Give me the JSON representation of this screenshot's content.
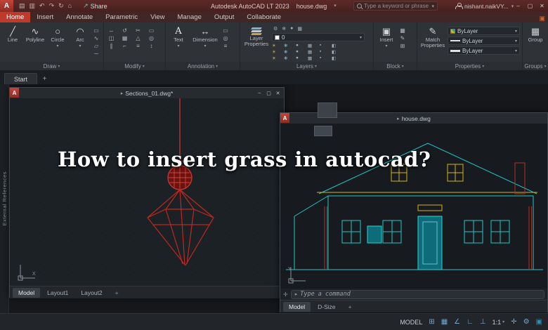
{
  "title_bar": {
    "app_title": "Autodesk AutoCAD LT 2023",
    "doc_title": "house.dwg",
    "share_label": "Share",
    "search_placeholder": "Type a keyword or phrase",
    "user_name": "nishant.naikVY..."
  },
  "icons": {
    "logo": "A",
    "qat": [
      "▤",
      "▥",
      "↶",
      "↷",
      "↻",
      "⌂"
    ],
    "share": "↗",
    "caret": "▾",
    "dwg_marker": "▸",
    "minimize": "–",
    "maximize": "▢",
    "close": "✕",
    "plus": "+",
    "ribbon_end": "▣",
    "draw_small": [
      "▭",
      "◇",
      "∿",
      "◯",
      "▱",
      "╳",
      "─",
      "∠"
    ],
    "modify": [
      "↔",
      "↺",
      "✂",
      "▭",
      "◫",
      "▦",
      "△",
      "◎",
      "∥",
      "⌐",
      "≡",
      "↕"
    ],
    "annotation_small": [
      "▭",
      "◎",
      "≡"
    ],
    "layers_top": [
      "⚙",
      "❄",
      "●",
      "▦"
    ],
    "layers_grid": [
      "☀",
      "❄",
      "●",
      "▦",
      "▪",
      "◧",
      "☀",
      "❄",
      "●",
      "▦",
      "▪",
      "◧",
      "☀",
      "❄",
      "●",
      "▦",
      "▪",
      "◧"
    ],
    "block_small": [
      "▦",
      "✎",
      "⊞"
    ],
    "cmd_prompt": "▸",
    "cmd_tool": "✛",
    "status": [
      "⊞",
      "▦",
      "∠",
      "∟",
      "⊥"
    ],
    "status2": [
      "✛",
      "⚙"
    ],
    "status_end": "▣"
  },
  "ribbon": {
    "tabs": [
      {
        "label": "Home"
      },
      {
        "label": "Insert"
      },
      {
        "label": "Annotate"
      },
      {
        "label": "Parametric"
      },
      {
        "label": "View"
      },
      {
        "label": "Manage"
      },
      {
        "label": "Output"
      },
      {
        "label": "Collaborate"
      }
    ],
    "draw_tools": [
      {
        "glyph": "╱",
        "label": "Line"
      },
      {
        "glyph": "∿",
        "label": "Polyline"
      },
      {
        "glyph": "○",
        "label": "Circle"
      },
      {
        "glyph": "◠",
        "label": "Arc"
      }
    ],
    "annotation": {
      "text_glyph": "A",
      "text_label": "Text",
      "dim_glyph": "↔",
      "dim_label": "Dimension"
    },
    "layers": {
      "layer_properties": "Layer Properties",
      "current_layer": "0"
    },
    "block": {
      "insert_glyph": "▣",
      "insert_label": "Insert"
    },
    "properties": {
      "match_glyph": "✎",
      "match_label": "Match Properties",
      "color_value": "ByLayer",
      "linetype_value": "ByLayer",
      "lineweight_value": "ByLayer"
    },
    "groups": {
      "group_glyph": "▦",
      "group_label": "Group"
    },
    "panel_labels": [
      "Draw",
      "Modify",
      "Annotation",
      "Layers",
      "Block",
      "Properties",
      "Groups"
    ]
  },
  "file_tabs": {
    "start": "Start"
  },
  "left_panel": {
    "label": "External References"
  },
  "overlay": {
    "headline": "How to insert grass in autocad?"
  },
  "sections_window": {
    "title": "Sections_01.dwg*",
    "tabs": [
      {
        "label": "Model"
      },
      {
        "label": "Layout1"
      },
      {
        "label": "Layout2"
      }
    ]
  },
  "house_window": {
    "title": "house.dwg",
    "command_placeholder": "Type a command",
    "tabs": [
      {
        "label": "Model"
      },
      {
        "label": "D-Size"
      }
    ]
  },
  "status_bar": {
    "model": "MODEL",
    "scale": "1:1"
  }
}
